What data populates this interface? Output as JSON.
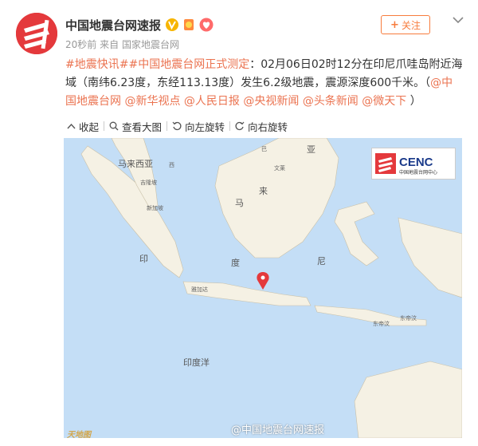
{
  "header": {
    "name": "中国地震台网速报",
    "follow_label": "关注",
    "time": "20秒前",
    "source_prefix": "来自",
    "source": "国家地震台网"
  },
  "post": {
    "tag1": "#地震快讯#",
    "tag2": "#中国地震台网正式测定",
    "body": "：02月06日02时12分在印尼爪哇岛附近海域（南纬6.23度，东经113.13度）发生6.2级地震，震源深度600千米。（",
    "mentions": [
      "@中国地震台网",
      "@新华视点",
      "@人民日报",
      "@央视新闻",
      "@头条新闻",
      "@微天下"
    ],
    "close": "）"
  },
  "toolbar": {
    "collapse": "收起",
    "view_large": "查看大图",
    "rotate_left": "向左旋转",
    "rotate_right": "向右旋转"
  },
  "map": {
    "labels": {
      "malaysia_west": "马来西亚",
      "kuala_lumpur": "吉隆坡",
      "singapore": "新加坡",
      "indonesia_yin": "印",
      "indonesia_du": "度",
      "indonesia_ni": "尼",
      "jakarta": "雅加达",
      "ma": "马",
      "lai": "来",
      "ya": "亚",
      "wenlai": "文莱",
      "east_timor": "东帝汶",
      "indian_ocean": "印度洋",
      "darwin": "东帝汶",
      "small_b": "巴",
      "small_c": "西"
    },
    "cenc_brand": "CENC",
    "cenc_sub": "中国地震台网中心",
    "watermark": "@中国地震台网速报",
    "tianditu": "天地图",
    "accent": "#e4393c",
    "sea_color": "#c4def6",
    "land_color": "#f5f1e4"
  },
  "colors": {
    "link": "#eb7350",
    "follow": "#f77c3d",
    "verified": "#f7b500"
  }
}
